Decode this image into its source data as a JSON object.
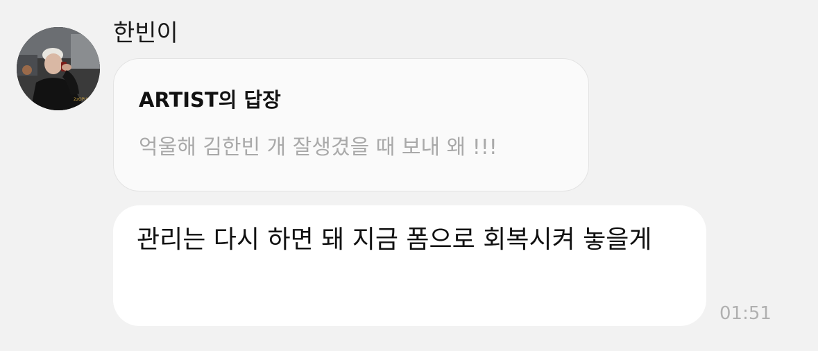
{
  "sender": {
    "name": "한빈이"
  },
  "reply": {
    "title": "ARTIST의 답장",
    "quote": "억울해 김한빈 개 잘생겼을 때 보내 왜 !!!"
  },
  "message": {
    "text": "관리는 다시 하면 돼 지금 폼으로 회복시켜 놓을게",
    "time": "01:51"
  }
}
